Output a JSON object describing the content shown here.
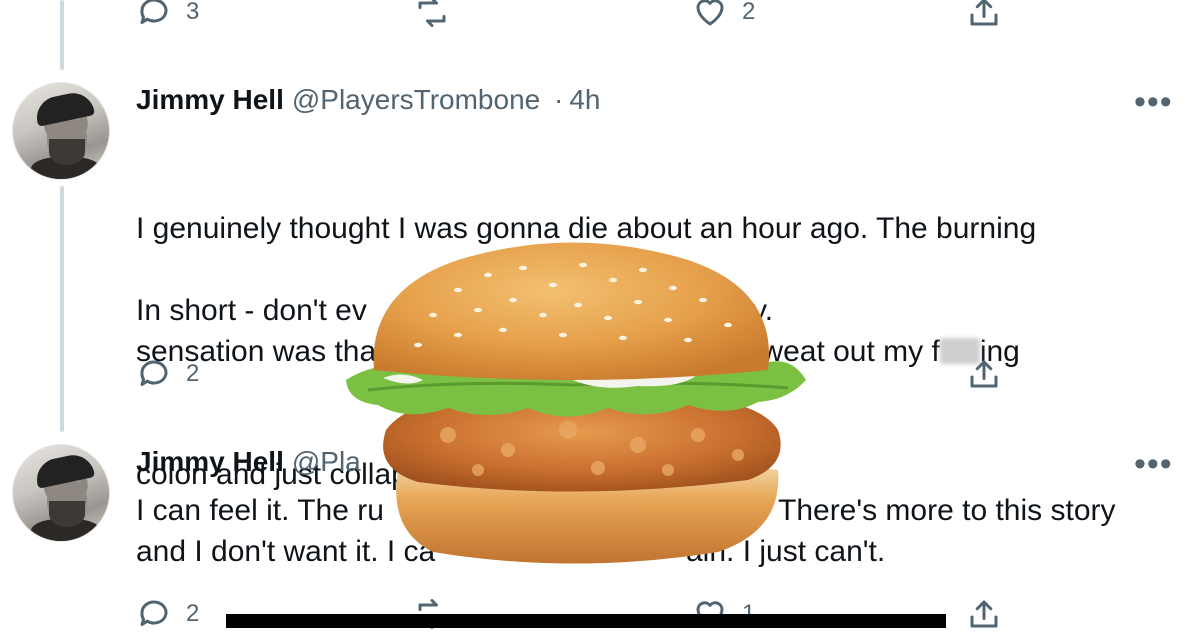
{
  "top_actions": {
    "reply_count": "3",
    "retweet_count": "",
    "like_count": "2"
  },
  "tweet1": {
    "name": "Jimmy Hell",
    "handle": "@PlayersTrombone",
    "separator": "·",
    "time": "4h",
    "more": "•••",
    "line1": "I genuinely thought I was gonna die about an hour ago. The burning",
    "line2a": "sensation was that bad I thought I was gonna sweat out my f",
    "line2b": "ing",
    "line3": "colon and just collapse on the bathroom floor.",
    "line4a": "In short - don't ev",
    "line4b": "y.",
    "reply_count": "2"
  },
  "tweet2": {
    "name": "Jimmy Hell",
    "handle": "@Pla",
    "more": "•••",
    "line1a": "I can feel it. The ru",
    "line1b": "There's more to this story",
    "line2a": "and I don't want it. I ca",
    "line2b": "ain. I just can't.",
    "reply_count": "2",
    "like_count": "1"
  },
  "overlay": {
    "image": "chicken-burger",
    "colors": {
      "bun": "#e8a24a",
      "lettuce": "#7bc043",
      "patty": "#c8702e"
    }
  }
}
